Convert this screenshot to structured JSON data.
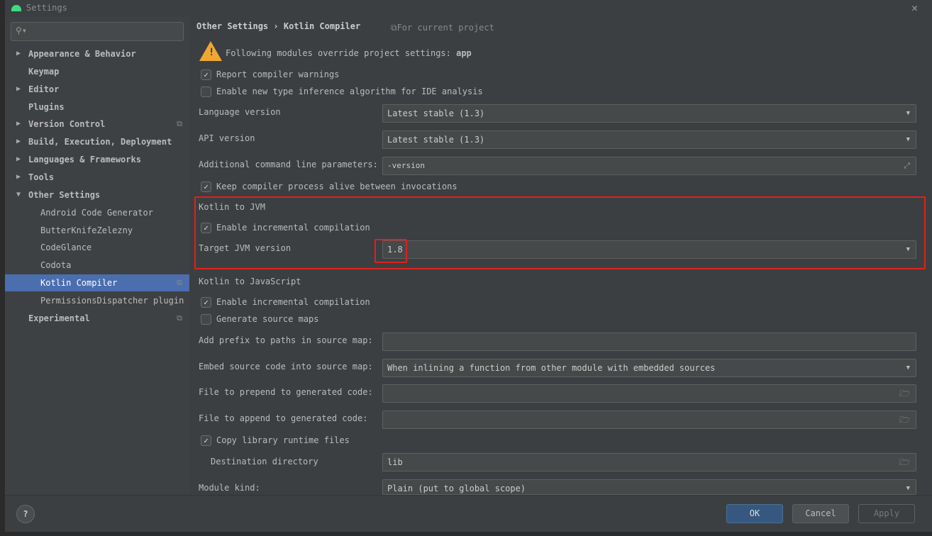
{
  "window": {
    "title": "Settings"
  },
  "sidebar": {
    "search_placeholder": "",
    "items": [
      {
        "label": "Appearance & Behavior",
        "arrow": "▶"
      },
      {
        "label": "Keymap",
        "arrow": ""
      },
      {
        "label": "Editor",
        "arrow": "▶"
      },
      {
        "label": "Plugins",
        "arrow": ""
      },
      {
        "label": "Version Control",
        "arrow": "▶"
      },
      {
        "label": "Build, Execution, Deployment",
        "arrow": "▶"
      },
      {
        "label": "Languages & Frameworks",
        "arrow": "▶"
      },
      {
        "label": "Tools",
        "arrow": "▶"
      },
      {
        "label": "Other Settings",
        "arrow": "▼"
      },
      {
        "label": "Android Code Generator"
      },
      {
        "label": "ButterKnifeZelezny"
      },
      {
        "label": "CodeGlance"
      },
      {
        "label": "Codota"
      },
      {
        "label": "Kotlin Compiler"
      },
      {
        "label": "PermissionsDispatcher plugin"
      },
      {
        "label": "Experimental",
        "arrow": ""
      }
    ]
  },
  "header": {
    "breadcrumb_parent": "Other Settings",
    "breadcrumb_sep": "›",
    "breadcrumb_current": "Kotlin Compiler",
    "scope": "For current project"
  },
  "warning": {
    "text": "Following modules override project settings: ",
    "module": "app"
  },
  "options": {
    "report_warnings": {
      "label": "Report compiler warnings",
      "checked": true
    },
    "new_inference": {
      "label": "Enable new type inference algorithm for IDE analysis",
      "checked": false
    },
    "language_version": {
      "label": "Language version",
      "value": "Latest stable (1.3)"
    },
    "api_version": {
      "label": "API version",
      "value": "Latest stable (1.3)"
    },
    "additional_params": {
      "label": "Additional command line parameters:",
      "value": "-version"
    },
    "keep_alive": {
      "label": "Keep compiler process alive between invocations",
      "checked": true
    }
  },
  "jvm": {
    "section": "Kotlin to JVM",
    "incremental": {
      "label": "Enable incremental compilation",
      "checked": true
    },
    "target": {
      "label": "Target JVM version",
      "value": "1.8"
    }
  },
  "js": {
    "section": "Kotlin to JavaScript",
    "incremental": {
      "label": "Enable incremental compilation",
      "checked": true
    },
    "source_maps": {
      "label": "Generate source maps",
      "checked": false
    },
    "prefix": {
      "label": "Add prefix to paths in source map:",
      "value": ""
    },
    "embed": {
      "label": "Embed source code into source map:",
      "value": "When inlining a function from other module with embedded sources"
    },
    "prepend": {
      "label": "File to prepend to generated code:",
      "value": ""
    },
    "append": {
      "label": "File to append to generated code:",
      "value": ""
    },
    "copy_runtime": {
      "label": "Copy library runtime files",
      "checked": true
    },
    "destination": {
      "label": "Destination directory",
      "value": "lib"
    },
    "module_kind": {
      "label": "Module kind:",
      "value": "Plain (put to global scope)"
    }
  },
  "footer": {
    "help": "?",
    "ok": "OK",
    "cancel": "Cancel",
    "apply": "Apply"
  },
  "colors": {
    "selection": "#4b6eaf",
    "highlight": "#e0201c",
    "warning": "#f0a732"
  }
}
